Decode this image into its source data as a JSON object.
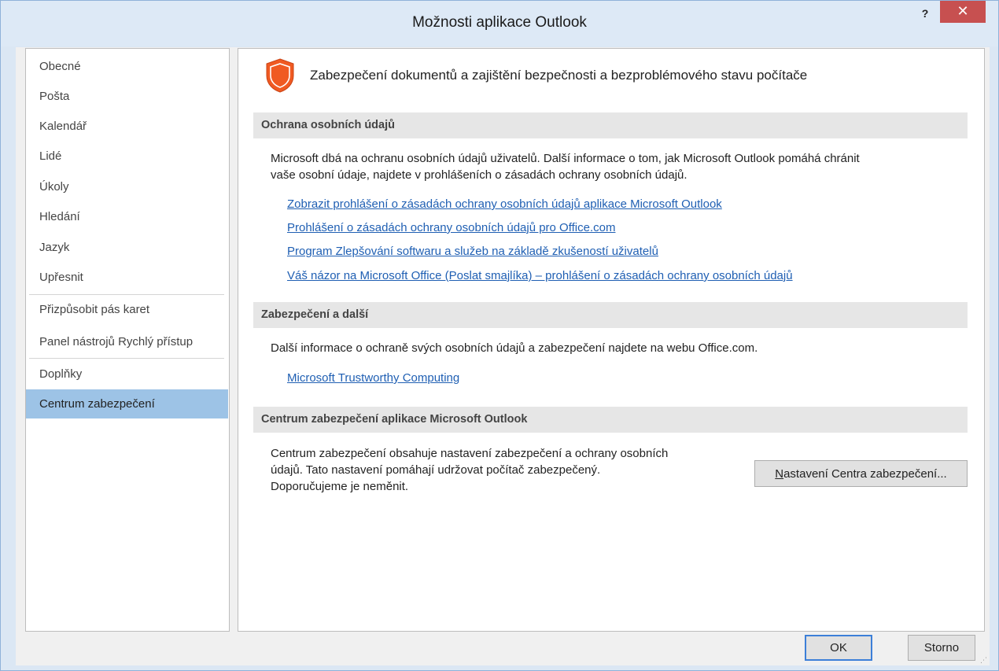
{
  "window": {
    "title": "Možnosti aplikace Outlook",
    "help_label": "?",
    "close_label": "✕"
  },
  "sidebar": {
    "items": [
      {
        "label": "Obecné"
      },
      {
        "label": "Pošta"
      },
      {
        "label": "Kalendář"
      },
      {
        "label": "Lidé"
      },
      {
        "label": "Úkoly"
      },
      {
        "label": "Hledání"
      },
      {
        "label": "Jazyk"
      },
      {
        "label": "Upřesnit"
      },
      {
        "label": "Přizpůsobit pás karet"
      },
      {
        "label": "Panel nástrojů Rychlý přístup"
      },
      {
        "label": "Doplňky"
      },
      {
        "label": "Centrum zabezpečení",
        "selected": true
      }
    ]
  },
  "main": {
    "heading": "Zabezpečení dokumentů a zajištění bezpečnosti a bezproblémového stavu počítače",
    "sections": {
      "privacy": {
        "title": "Ochrana osobních údajů",
        "text_line1": "Microsoft dbá na ochranu osobních údajů uživatelů. Další informace o tom, jak Microsoft Outlook pomáhá chránit",
        "text_line2": "vaše osobní údaje, najdete v prohlášeních o zásadách ochrany osobních údajů.",
        "links": [
          "Zobrazit prohlášení o zásadách ochrany osobních údajů aplikace Microsoft Outlook",
          "Prohlášení o zásadách ochrany osobních údajů pro Office.com",
          "Program Zlepšování softwaru a služeb na základě zkušeností uživatelů",
          "Váš názor na Microsoft Office (Poslat smajlíka) – prohlášení o zásadách ochrany osobních údajů"
        ]
      },
      "security": {
        "title": "Zabezpečení a další",
        "text": "Další informace o ochraně svých osobních údajů a zabezpečení najdete na webu Office.com.",
        "link": "Microsoft Trustworthy Computing"
      },
      "trust_center": {
        "title": "Centrum zabezpečení aplikace Microsoft Outlook",
        "text_line1": "Centrum zabezpečení obsahuje nastavení zabezpečení a ochrany osobních",
        "text_line2": "údajů. Tato nastavení pomáhají udržovat počítač zabezpečený.",
        "text_line3": "Doporučujeme je neměnit.",
        "button_accel": "N",
        "button_rest": "astavení Centra zabezpečení..."
      }
    }
  },
  "footer": {
    "ok_label": "OK",
    "cancel_label": "Storno"
  },
  "colors": {
    "shield_orange": "#f05a22",
    "link_blue": "#1f5fb3",
    "selected_nav": "#9dc3e6",
    "close_red": "#c75050"
  },
  "icons": {
    "shield": "shield-icon",
    "help": "help-icon",
    "close": "close-icon",
    "grip": "resize-grip-icon"
  }
}
